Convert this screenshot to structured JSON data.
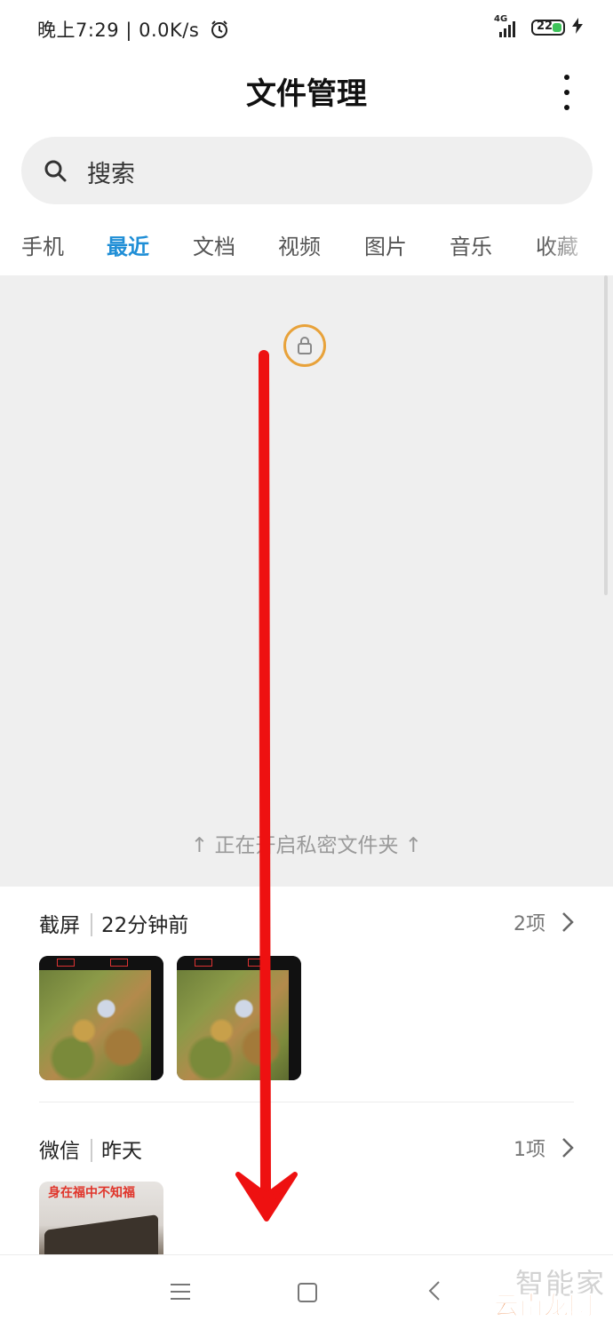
{
  "status_bar": {
    "time": "晚上7:29",
    "speed": "0.0K/s",
    "network": "4G",
    "battery": "22",
    "separator": "|"
  },
  "header": {
    "title": "文件管理"
  },
  "search": {
    "placeholder": "搜索"
  },
  "tabs": [
    {
      "label": "手机"
    },
    {
      "label": "最近",
      "active": true
    },
    {
      "label": "文档"
    },
    {
      "label": "视频"
    },
    {
      "label": "图片"
    },
    {
      "label": "音乐"
    },
    {
      "label": "收藏"
    }
  ],
  "private_folder": {
    "hint": "↑ 正在开启私密文件夹 ↑"
  },
  "sections": [
    {
      "name": "截屏",
      "time": "22分钟前",
      "count": "2项"
    },
    {
      "name": "微信",
      "time": "昨天",
      "count": "1项",
      "thumb_text": "身在福中不知福"
    }
  ],
  "watermark": {
    "top": "智能家",
    "bottom": "云南龙网"
  },
  "colors": {
    "accent": "#1f8ed6",
    "lock_ring": "#e8a23a",
    "arrow": "#ee1111",
    "battery_fill": "#3ec35a"
  },
  "icons": [
    "alarm-icon",
    "signal-icon",
    "battery-icon",
    "charging-icon",
    "more-icon",
    "search-icon",
    "lock-icon",
    "chevron-right-icon",
    "menu-icon",
    "home-icon",
    "back-icon"
  ]
}
